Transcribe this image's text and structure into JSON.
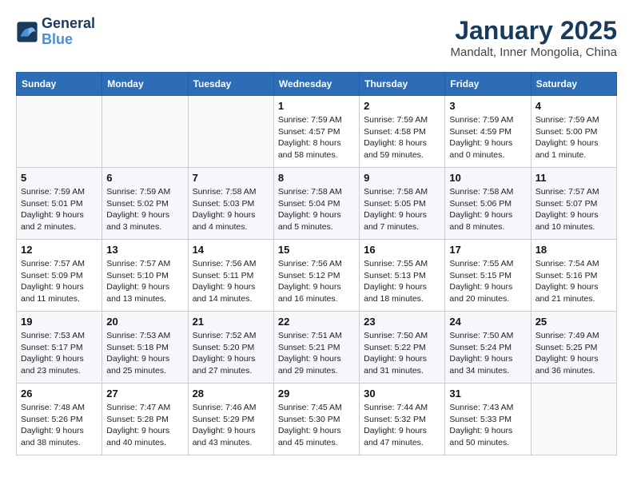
{
  "logo": {
    "line1": "General",
    "line2": "Blue"
  },
  "title": "January 2025",
  "subtitle": "Mandalt, Inner Mongolia, China",
  "days_header": [
    "Sunday",
    "Monday",
    "Tuesday",
    "Wednesday",
    "Thursday",
    "Friday",
    "Saturday"
  ],
  "weeks": [
    [
      {
        "day": "",
        "info": ""
      },
      {
        "day": "",
        "info": ""
      },
      {
        "day": "",
        "info": ""
      },
      {
        "day": "1",
        "info": "Sunrise: 7:59 AM\nSunset: 4:57 PM\nDaylight: 8 hours and 58 minutes."
      },
      {
        "day": "2",
        "info": "Sunrise: 7:59 AM\nSunset: 4:58 PM\nDaylight: 8 hours and 59 minutes."
      },
      {
        "day": "3",
        "info": "Sunrise: 7:59 AM\nSunset: 4:59 PM\nDaylight: 9 hours and 0 minutes."
      },
      {
        "day": "4",
        "info": "Sunrise: 7:59 AM\nSunset: 5:00 PM\nDaylight: 9 hours and 1 minute."
      }
    ],
    [
      {
        "day": "5",
        "info": "Sunrise: 7:59 AM\nSunset: 5:01 PM\nDaylight: 9 hours and 2 minutes."
      },
      {
        "day": "6",
        "info": "Sunrise: 7:59 AM\nSunset: 5:02 PM\nDaylight: 9 hours and 3 minutes."
      },
      {
        "day": "7",
        "info": "Sunrise: 7:58 AM\nSunset: 5:03 PM\nDaylight: 9 hours and 4 minutes."
      },
      {
        "day": "8",
        "info": "Sunrise: 7:58 AM\nSunset: 5:04 PM\nDaylight: 9 hours and 5 minutes."
      },
      {
        "day": "9",
        "info": "Sunrise: 7:58 AM\nSunset: 5:05 PM\nDaylight: 9 hours and 7 minutes."
      },
      {
        "day": "10",
        "info": "Sunrise: 7:58 AM\nSunset: 5:06 PM\nDaylight: 9 hours and 8 minutes."
      },
      {
        "day": "11",
        "info": "Sunrise: 7:57 AM\nSunset: 5:07 PM\nDaylight: 9 hours and 10 minutes."
      }
    ],
    [
      {
        "day": "12",
        "info": "Sunrise: 7:57 AM\nSunset: 5:09 PM\nDaylight: 9 hours and 11 minutes."
      },
      {
        "day": "13",
        "info": "Sunrise: 7:57 AM\nSunset: 5:10 PM\nDaylight: 9 hours and 13 minutes."
      },
      {
        "day": "14",
        "info": "Sunrise: 7:56 AM\nSunset: 5:11 PM\nDaylight: 9 hours and 14 minutes."
      },
      {
        "day": "15",
        "info": "Sunrise: 7:56 AM\nSunset: 5:12 PM\nDaylight: 9 hours and 16 minutes."
      },
      {
        "day": "16",
        "info": "Sunrise: 7:55 AM\nSunset: 5:13 PM\nDaylight: 9 hours and 18 minutes."
      },
      {
        "day": "17",
        "info": "Sunrise: 7:55 AM\nSunset: 5:15 PM\nDaylight: 9 hours and 20 minutes."
      },
      {
        "day": "18",
        "info": "Sunrise: 7:54 AM\nSunset: 5:16 PM\nDaylight: 9 hours and 21 minutes."
      }
    ],
    [
      {
        "day": "19",
        "info": "Sunrise: 7:53 AM\nSunset: 5:17 PM\nDaylight: 9 hours and 23 minutes."
      },
      {
        "day": "20",
        "info": "Sunrise: 7:53 AM\nSunset: 5:18 PM\nDaylight: 9 hours and 25 minutes."
      },
      {
        "day": "21",
        "info": "Sunrise: 7:52 AM\nSunset: 5:20 PM\nDaylight: 9 hours and 27 minutes."
      },
      {
        "day": "22",
        "info": "Sunrise: 7:51 AM\nSunset: 5:21 PM\nDaylight: 9 hours and 29 minutes."
      },
      {
        "day": "23",
        "info": "Sunrise: 7:50 AM\nSunset: 5:22 PM\nDaylight: 9 hours and 31 minutes."
      },
      {
        "day": "24",
        "info": "Sunrise: 7:50 AM\nSunset: 5:24 PM\nDaylight: 9 hours and 34 minutes."
      },
      {
        "day": "25",
        "info": "Sunrise: 7:49 AM\nSunset: 5:25 PM\nDaylight: 9 hours and 36 minutes."
      }
    ],
    [
      {
        "day": "26",
        "info": "Sunrise: 7:48 AM\nSunset: 5:26 PM\nDaylight: 9 hours and 38 minutes."
      },
      {
        "day": "27",
        "info": "Sunrise: 7:47 AM\nSunset: 5:28 PM\nDaylight: 9 hours and 40 minutes."
      },
      {
        "day": "28",
        "info": "Sunrise: 7:46 AM\nSunset: 5:29 PM\nDaylight: 9 hours and 43 minutes."
      },
      {
        "day": "29",
        "info": "Sunrise: 7:45 AM\nSunset: 5:30 PM\nDaylight: 9 hours and 45 minutes."
      },
      {
        "day": "30",
        "info": "Sunrise: 7:44 AM\nSunset: 5:32 PM\nDaylight: 9 hours and 47 minutes."
      },
      {
        "day": "31",
        "info": "Sunrise: 7:43 AM\nSunset: 5:33 PM\nDaylight: 9 hours and 50 minutes."
      },
      {
        "day": "",
        "info": ""
      }
    ]
  ]
}
